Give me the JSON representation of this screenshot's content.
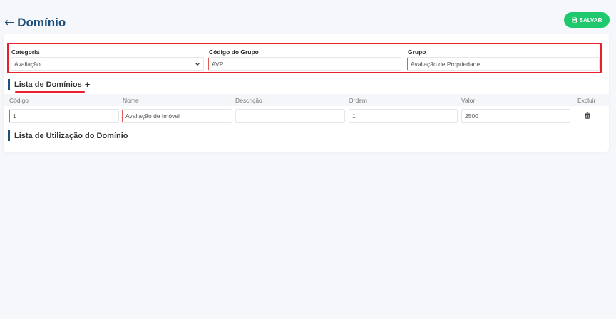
{
  "header": {
    "back_icon": "arrow-left-icon",
    "title": "Domínio",
    "save_label": "SALVAR",
    "save_color": "#1fc86c",
    "save_icon": "floppy-disk-icon"
  },
  "form": {
    "categoria": {
      "label": "Categoria",
      "value": "Avaliação"
    },
    "codigo_grupo": {
      "label": "Código do Grupo",
      "value": "AVP"
    },
    "grupo": {
      "label": "Grupo",
      "value": "Avaliação de Propriedade"
    }
  },
  "dominios": {
    "title": "Lista de Domínios",
    "add_icon": "plus-icon",
    "columns": [
      "Código",
      "Nome",
      "Descrição",
      "Ordem",
      "Valor",
      "Excluir"
    ],
    "rows": [
      {
        "codigo": "1",
        "nome": "Avaliação de Imóvel",
        "descricao": "",
        "ordem": "1",
        "valor": "2500",
        "delete_icon": "trash-icon"
      }
    ]
  },
  "utilizacao": {
    "title": "Lista de Utilização do Domínio"
  },
  "colors": {
    "accent": "#1e4f7a",
    "highlight": "#e81f2c",
    "required_marker": "#e05a5a"
  }
}
